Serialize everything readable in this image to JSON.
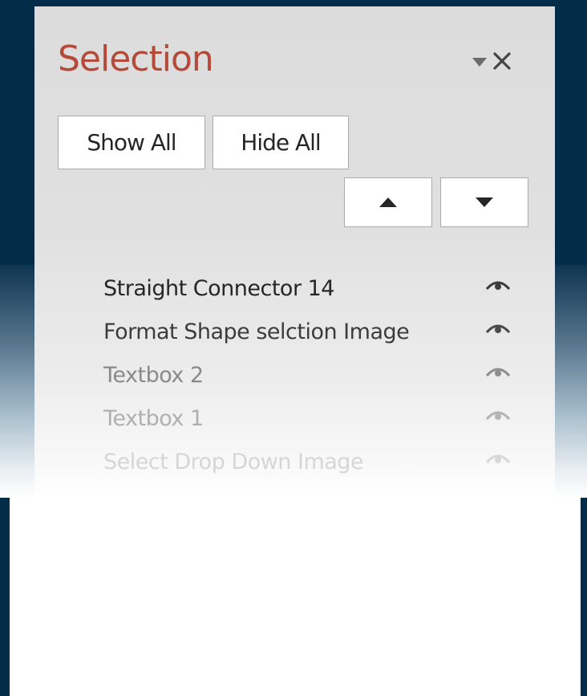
{
  "pane": {
    "title": "Selection",
    "title_color": "#b44a3a",
    "options_icon": "caret-down-icon",
    "close_icon": "close-icon"
  },
  "toolbar": {
    "show_all_label": "Show All",
    "hide_all_label": "Hide All",
    "bring_forward_icon": "triangle-up-icon",
    "send_backward_icon": "triangle-down-icon"
  },
  "items": [
    {
      "label": "Straight Connector 14",
      "color": "#262626",
      "icon": "eye-icon"
    },
    {
      "label": "Format Shape selction Image",
      "color": "#3c3c3c",
      "icon": "eye-icon"
    },
    {
      "label": "Textbox 2",
      "color": "#8a8a8a",
      "icon": "eye-icon"
    },
    {
      "label": "Textbox 1",
      "color": "#b0b0b0",
      "icon": "eye-icon"
    },
    {
      "label": "Select Drop Down Image",
      "color": "#d6d6d6",
      "icon": "eye-icon"
    },
    {
      "label": "",
      "color": "#f4f4f4",
      "icon": "eye-icon"
    }
  ],
  "colors": {
    "background_dark": "#032c48",
    "pane_background": "#dcdcdc",
    "button_border": "#ababab"
  }
}
